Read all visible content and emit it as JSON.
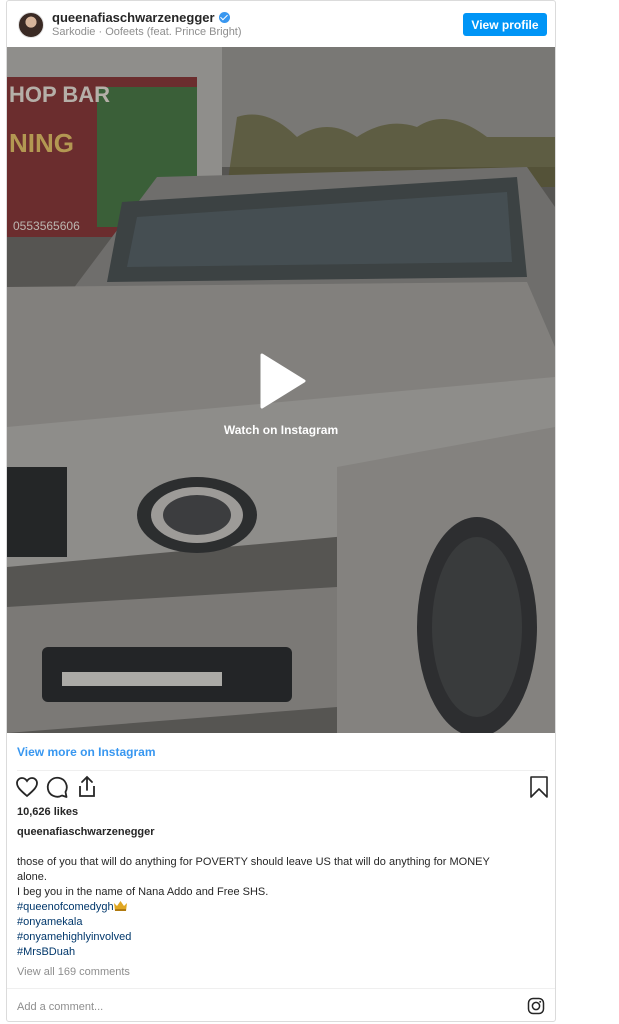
{
  "header": {
    "username": "queenafiaschwarzenegger",
    "subline": "Sarkodie · Oofeets (feat. Prince Bright)",
    "view_profile_label": "View profile"
  },
  "media": {
    "watch_label": "Watch on Instagram",
    "storefront_text": "HOP BAR",
    "storefront_sign": "NING",
    "phone_text": "0553565606"
  },
  "view_more_label": "View more on Instagram",
  "post": {
    "likes": "10,626 likes",
    "caption_user": "queenafiaschwarzenegger",
    "caption_lines": [
      "those of you that will do anything for POVERTY should leave US that will do anything for MONEY",
      "alone.",
      "I beg you in the name of Nana Addo and Free SHS."
    ],
    "hashtags": [
      "#queenofcomedygh",
      "#onyamekala",
      "#onyamehighlyinvolved",
      "#MrsBDuah"
    ],
    "view_comments": "View all 169 comments",
    "add_comment_placeholder": "Add a comment..."
  },
  "icons": {
    "like": "heart-icon",
    "comment": "comment-icon",
    "share": "share-icon",
    "save": "bookmark-icon",
    "instagram": "instagram-icon",
    "verified": "verified-badge-icon",
    "play": "play-icon",
    "crown": "crown-emoji-icon"
  },
  "colors": {
    "accent": "#0095f6",
    "link": "#3897f0",
    "hashtag": "#00376b",
    "muted": "#8e8e8e"
  }
}
